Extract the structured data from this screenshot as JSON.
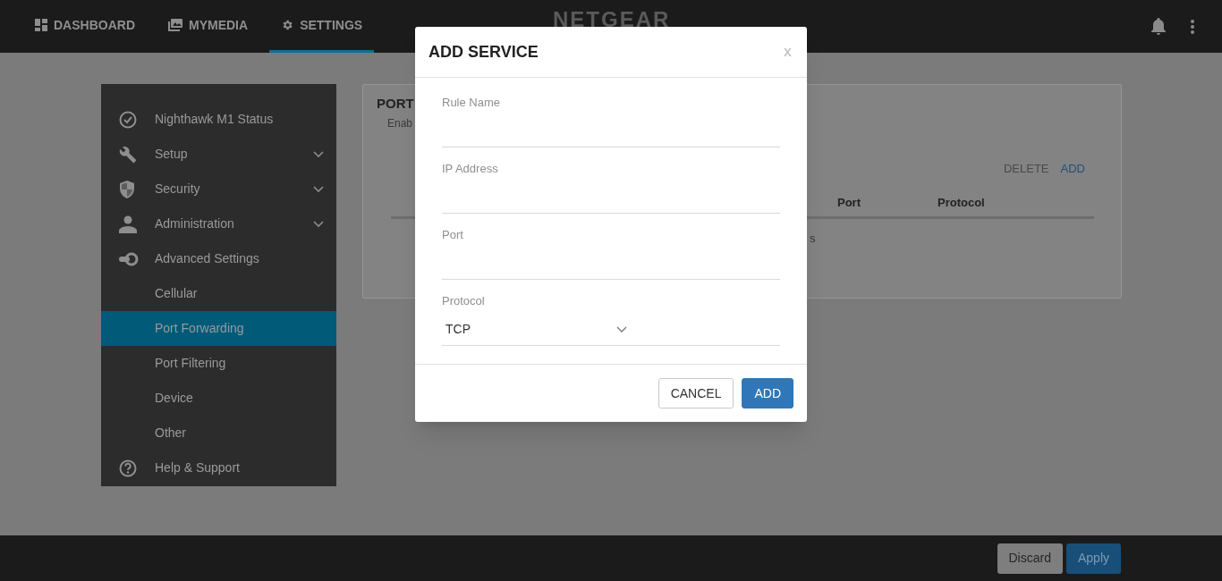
{
  "header": {
    "tabs": [
      {
        "label": "DASHBOARD",
        "selected": false
      },
      {
        "label": "MYMEDIA",
        "selected": false
      },
      {
        "label": "SETTINGS",
        "selected": true
      }
    ],
    "logo": "NETGEAR"
  },
  "sidebar": {
    "items": [
      {
        "label": "Nighthawk M1 Status",
        "expandable": false,
        "selected": false
      },
      {
        "label": "Setup",
        "expandable": true,
        "selected": false
      },
      {
        "label": "Security",
        "expandable": true,
        "selected": false
      },
      {
        "label": "Administration",
        "expandable": true,
        "selected": false
      },
      {
        "label": "Advanced Settings",
        "expandable": false,
        "selected": false
      },
      {
        "label": "Cellular",
        "expandable": false,
        "selected": false
      },
      {
        "label": "Port Forwarding",
        "expandable": false,
        "selected": true
      },
      {
        "label": "Port Filtering",
        "expandable": false,
        "selected": false
      },
      {
        "label": "Device",
        "expandable": false,
        "selected": false
      },
      {
        "label": "Other",
        "expandable": false,
        "selected": false
      },
      {
        "label": "Help & Support",
        "expandable": false,
        "selected": false
      }
    ]
  },
  "card": {
    "title": "PORT",
    "subtitle": "Enab",
    "actions": [
      "DELETE",
      "ADD"
    ],
    "columns": [
      "Port",
      "Protocol"
    ],
    "row_fragment": "s"
  },
  "dialog": {
    "title": "ADD SERVICE",
    "close": "x",
    "fields": [
      {
        "label": "Rule Name",
        "kind": "text"
      },
      {
        "label": "IP Address",
        "kind": "text"
      },
      {
        "label": "Port",
        "kind": "text"
      },
      {
        "label": "Protocol",
        "kind": "select",
        "value": "TCP"
      }
    ],
    "buttons": [
      {
        "label": "CANCEL",
        "kind": "secondary"
      },
      {
        "label": "ADD",
        "kind": "primary"
      }
    ]
  },
  "footer": {
    "buttons": [
      {
        "label": "Discard",
        "kind": "secondary"
      },
      {
        "label": "Apply",
        "kind": "primary"
      }
    ]
  }
}
